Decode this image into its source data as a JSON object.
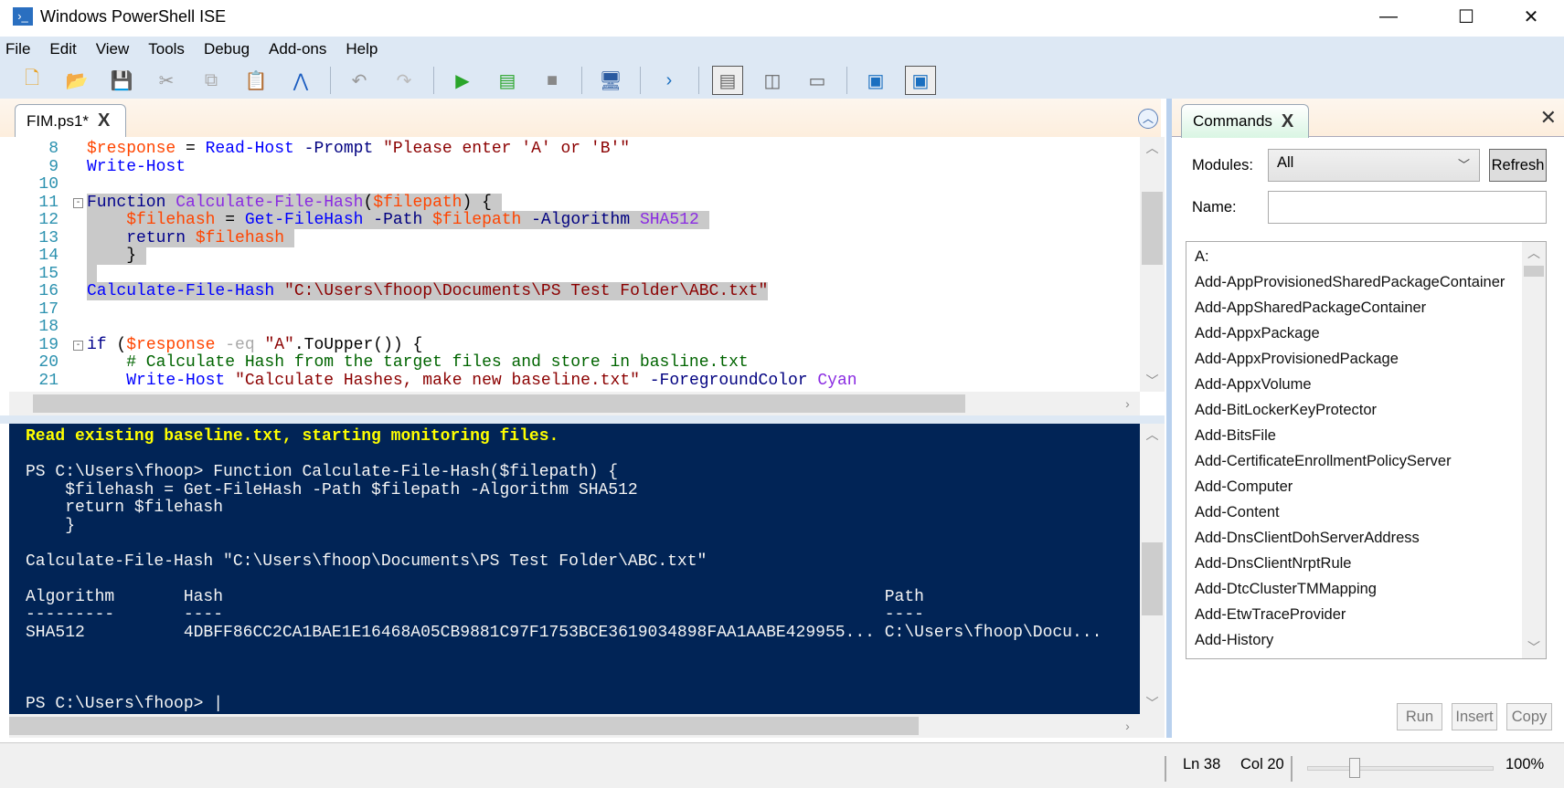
{
  "window": {
    "title": "Windows PowerShell ISE",
    "minimize": "—",
    "maximize": "☐",
    "close": "✕"
  },
  "menu": [
    "File",
    "Edit",
    "View",
    "Tools",
    "Debug",
    "Add-ons",
    "Help"
  ],
  "toolbar": [
    "new-icon",
    "open-icon",
    "save-icon",
    "cut-icon",
    "copy-icon",
    "paste-icon",
    "clear-icon",
    "undo-icon",
    "redo-icon",
    "run-icon",
    "run-selection-icon",
    "stop-icon",
    "remote-icon",
    "powershell-icon",
    "layout-top-icon",
    "layout-right-icon",
    "layout-max-icon",
    "show-script-icon",
    "show-commands-icon"
  ],
  "editor": {
    "tab": "FIM.ps1*",
    "tab_close": "X",
    "lines": [
      {
        "n": "8",
        "toks": [
          [
            "$response",
            "var"
          ],
          [
            " = ",
            "def"
          ],
          [
            "Read-Host",
            "cmd"
          ],
          [
            " -Prompt ",
            "par"
          ],
          [
            "\"Please enter 'A' or 'B'\"",
            "str"
          ]
        ]
      },
      {
        "n": "9",
        "toks": [
          [
            "Write-Host",
            "cmd"
          ]
        ]
      },
      {
        "n": "10",
        "toks": []
      },
      {
        "n": "11",
        "fold": "-",
        "sel": true,
        "toks": [
          [
            "Function ",
            "kw"
          ],
          [
            "Calculate-File-Hash",
            "fn"
          ],
          [
            "(",
            "def"
          ],
          [
            "$filepath",
            "var"
          ],
          [
            ") { ",
            "def"
          ]
        ]
      },
      {
        "n": "12",
        "sel": true,
        "toks": [
          [
            "    ",
            "def"
          ],
          [
            "$filehash",
            "var"
          ],
          [
            " = ",
            "def"
          ],
          [
            "Get-FileHash",
            "cmd"
          ],
          [
            " -Path ",
            "par"
          ],
          [
            "$filepath",
            "var"
          ],
          [
            " -Algorithm ",
            "par"
          ],
          [
            "SHA512",
            "fn"
          ],
          [
            " ",
            "def"
          ]
        ]
      },
      {
        "n": "13",
        "sel": true,
        "toks": [
          [
            "    return ",
            "kw"
          ],
          [
            "$filehash",
            "var"
          ],
          [
            " ",
            "def"
          ]
        ]
      },
      {
        "n": "14",
        "sel": true,
        "toks": [
          [
            "    } ",
            "def"
          ]
        ]
      },
      {
        "n": "15",
        "sel": true,
        "toks": [
          [
            " ",
            "def"
          ]
        ]
      },
      {
        "n": "16",
        "sel": true,
        "toks": [
          [
            "Calculate-File-Hash",
            "cmd"
          ],
          [
            " ",
            "def"
          ],
          [
            "\"C:\\Users\\fhoop\\Documents\\PS Test Folder\\ABC.txt\"",
            "str"
          ]
        ]
      },
      {
        "n": "17",
        "toks": []
      },
      {
        "n": "18",
        "toks": []
      },
      {
        "n": "19",
        "fold": "-",
        "toks": [
          [
            "if",
            "kw"
          ],
          [
            " (",
            "def"
          ],
          [
            "$response",
            "var"
          ],
          [
            " -eq ",
            "op"
          ],
          [
            "\"A\"",
            "str"
          ],
          [
            ".ToUpper()) {",
            "def"
          ]
        ]
      },
      {
        "n": "20",
        "toks": [
          [
            "    # Calculate Hash from the target files and store in basline.txt",
            "cmt"
          ]
        ]
      },
      {
        "n": "21",
        "toks": [
          [
            "    ",
            "def"
          ],
          [
            "Write-Host",
            "cmd"
          ],
          [
            " ",
            "def"
          ],
          [
            "\"Calculate Hashes, make new baseline.txt\"",
            "str"
          ],
          [
            " -ForegroundColor ",
            "par"
          ],
          [
            "Cyan",
            "fn"
          ]
        ]
      }
    ]
  },
  "console": {
    "highlight": "Read existing baseline.txt, starting monitoring files.",
    "body": "\nPS C:\\Users\\fhoop> Function Calculate-File-Hash($filepath) {\n    $filehash = Get-FileHash -Path $filepath -Algorithm SHA512\n    return $filehash\n    }\n\nCalculate-File-Hash \"C:\\Users\\fhoop\\Documents\\PS Test Folder\\ABC.txt\"\n\nAlgorithm       Hash                                                                   Path\n---------       ----                                                                   ----\nSHA512          4DBFF86CC2CA1BAE1E16468A05CB9881C97F1753BCE3619034898FAA1AABE429955... C:\\Users\\fhoop\\Docu...\n\n\n\nPS C:\\Users\\fhoop> |"
  },
  "commands": {
    "tab": "Commands",
    "tab_close": "X",
    "close": "✕",
    "modules_label": "Modules:",
    "modules_value": "All",
    "refresh": "Refresh",
    "name_label": "Name:",
    "name_value": "",
    "items": [
      "A:",
      "Add-AppProvisionedSharedPackageContainer",
      "Add-AppSharedPackageContainer",
      "Add-AppxPackage",
      "Add-AppxProvisionedPackage",
      "Add-AppxVolume",
      "Add-BitLockerKeyProtector",
      "Add-BitsFile",
      "Add-CertificateEnrollmentPolicyServer",
      "Add-Computer",
      "Add-Content",
      "Add-DnsClientDohServerAddress",
      "Add-DnsClientNrptRule",
      "Add-DtcClusterTMMapping",
      "Add-EtwTraceProvider",
      "Add-History"
    ],
    "run": "Run",
    "insert": "Insert",
    "copy": "Copy"
  },
  "status": {
    "ln": "Ln 38",
    "col": "Col 20",
    "zoom": "100%",
    "zoom_fraction": 0.25
  }
}
